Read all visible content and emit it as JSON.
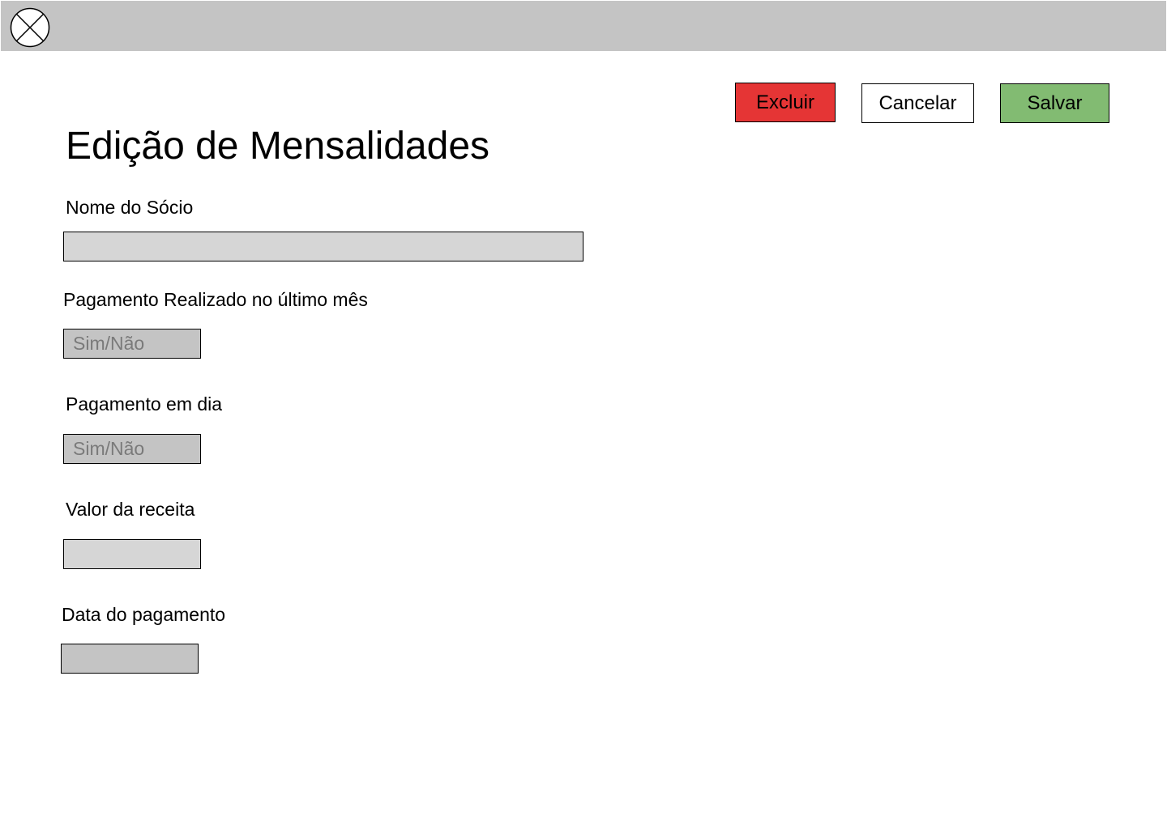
{
  "header": {
    "logo_icon": "close-circle-icon",
    "background_color": "#c4c4c4"
  },
  "actions": {
    "delete_label": "Excluir",
    "delete_color": "#e53535",
    "cancel_label": "Cancelar",
    "save_label": "Salvar",
    "save_color": "#82bb72"
  },
  "page": {
    "title": "Edição de Mensalidades"
  },
  "form": {
    "member_name": {
      "label": "Nome do Sócio",
      "value": ""
    },
    "paid_last_month": {
      "label": "Pagamento Realizado no último mês",
      "placeholder": "Sim/Não"
    },
    "payment_on_time": {
      "label": "Pagamento em dia",
      "placeholder": "Sim/Não"
    },
    "revenue_value": {
      "label": "Valor da receita",
      "value": ""
    },
    "payment_date": {
      "label": "Data do pagamento",
      "value": ""
    }
  }
}
